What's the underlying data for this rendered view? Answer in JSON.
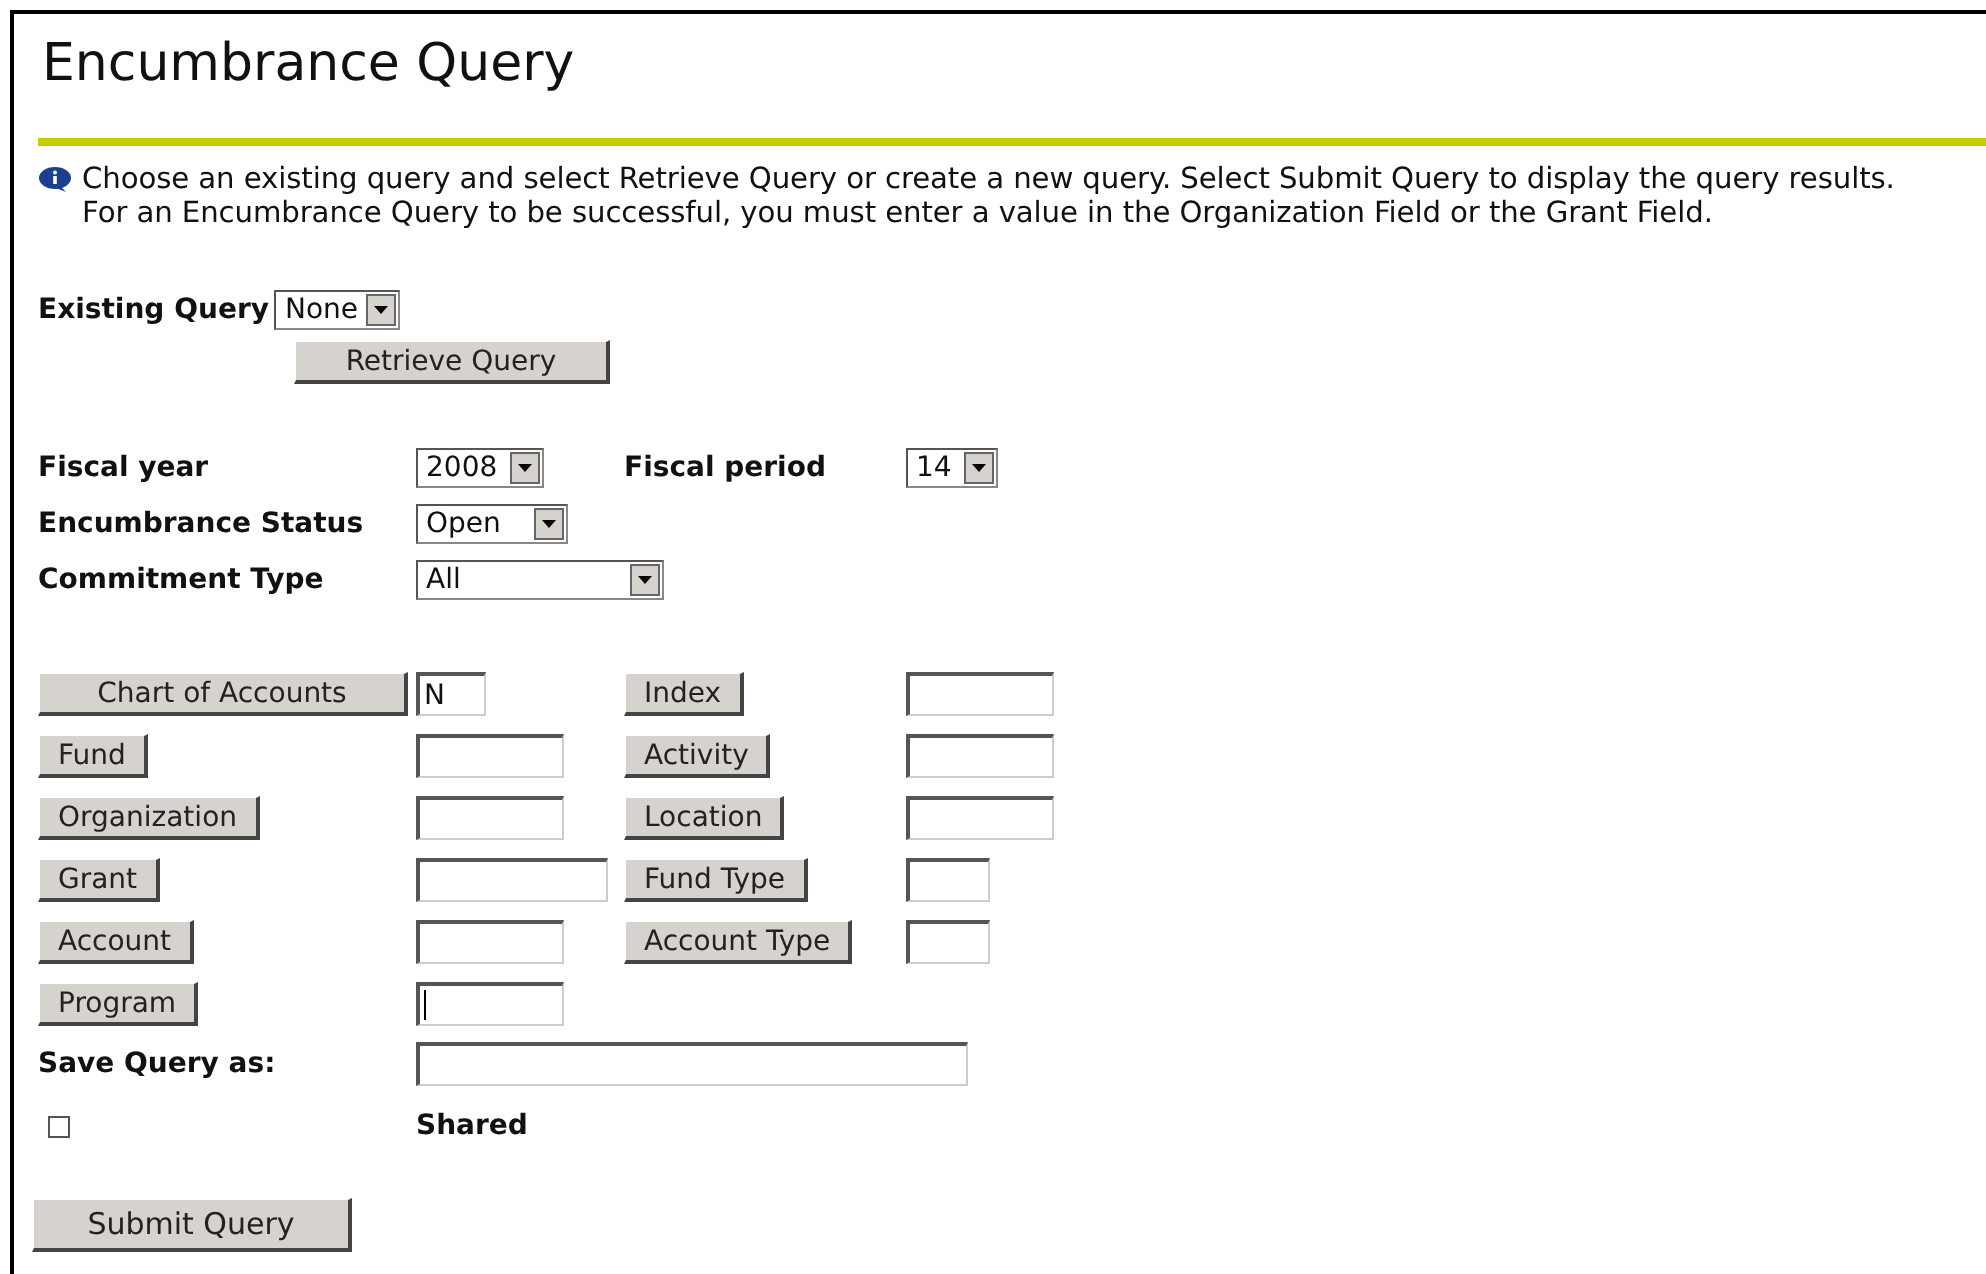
{
  "title": "Encumbrance Query",
  "info": [
    "Choose an existing query and select Retrieve Query or create a new query. Select Submit Query to display the query results.",
    "For an Encumbrance Query to be successful, you must enter a value in the Organization Field or the Grant Field."
  ],
  "existing_query": {
    "label": "Existing Query",
    "value": "None"
  },
  "retrieve_button": "Retrieve Query",
  "selects": [
    {
      "label": "Fiscal year",
      "value": "2008",
      "extra": {
        "label": "Fiscal period",
        "value": "14"
      }
    },
    {
      "label": "Encumbrance Status",
      "value": "Open"
    },
    {
      "label": "Commitment Type",
      "value": "All"
    }
  ],
  "lookups": [
    {
      "button": "Chart of Accounts",
      "value": "N",
      "right": {
        "button": "Index"
      }
    },
    {
      "button": "Fund",
      "right": {
        "button": "Activity"
      }
    },
    {
      "button": "Organization",
      "right": {
        "button": "Location"
      }
    },
    {
      "button": "Grant",
      "right": {
        "button": "Fund Type"
      }
    },
    {
      "button": "Account",
      "right": {
        "button": "Account Type"
      }
    },
    {
      "button": "Program",
      "focused": true
    }
  ],
  "save_query": {
    "label": "Save Query as:"
  },
  "shared": {
    "label": "Shared",
    "checked": false
  },
  "submit_button": "Submit Query"
}
